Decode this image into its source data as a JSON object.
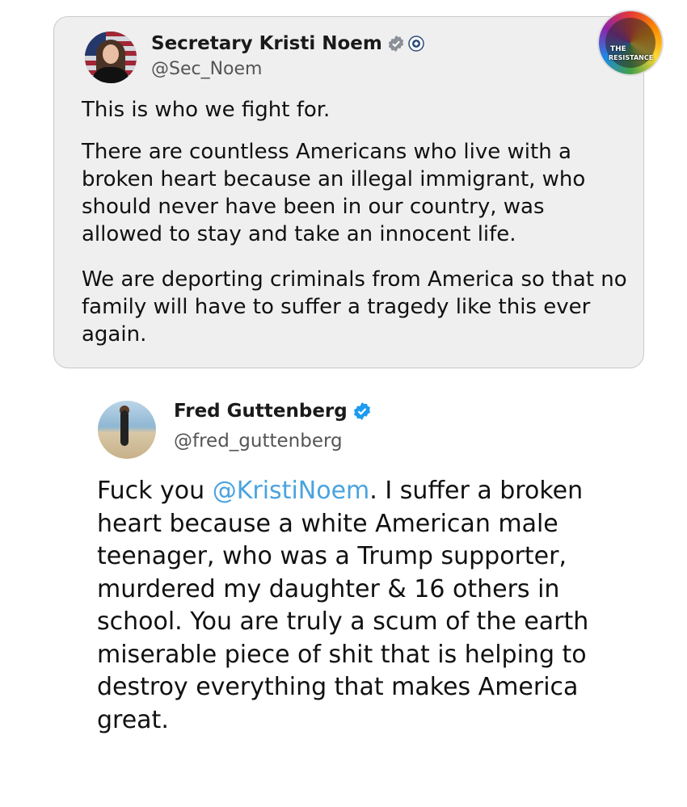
{
  "quoted_post": {
    "author_name": "Secretary Kristi Noem",
    "handle": "@Sec_Noem",
    "paragraphs": [
      "This is who we fight for.",
      "There are countless Americans who live with a broken heart because an illegal immigrant, who should never have been in our country, was allowed to stay and take an innocent life.",
      "We are deporting criminals from America so that no family will have to suffer a tragedy like this ever again."
    ]
  },
  "watermark": {
    "line1": "THE",
    "line2": "RESISTANCE"
  },
  "reply_post": {
    "author_name": "Fred Guttenberg",
    "handle": "@fred_guttenberg",
    "text_before": "Fuck you ",
    "mention": "@KristiNoem",
    "text_after": ". I suffer a broken heart because a white American male teenager, who was a Trump supporter, murdered my daughter & 16 others in school. You are truly a scum of the earth miserable piece of shit that is helping to destroy everything that makes America great."
  },
  "colors": {
    "verified": "#1d9bf0",
    "mention": "#4aa3df",
    "card_bg": "#efefef"
  },
  "icons": {
    "verified": "verified-badge-icon",
    "agency": "dhs-seal-icon"
  }
}
